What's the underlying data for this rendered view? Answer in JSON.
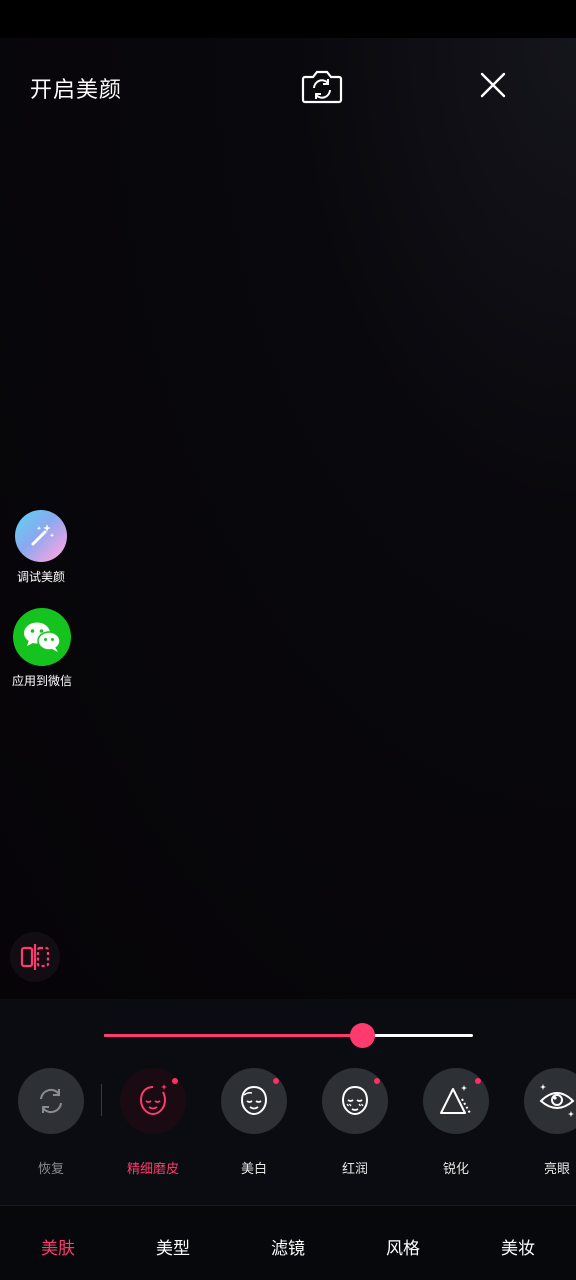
{
  "header": {
    "title": "开启美颜"
  },
  "side": {
    "tune_label": "调试美颜",
    "wechat_label": "应用到微信"
  },
  "slider": {
    "value_fraction": 0.7
  },
  "tools": [
    {
      "label": "恢复",
      "icon": "reset-icon",
      "active": false,
      "dot": false
    },
    {
      "label": "精细磨皮",
      "icon": "face-smooth-icon",
      "active": true,
      "dot": true
    },
    {
      "label": "美白",
      "icon": "face-whiten-icon",
      "active": false,
      "dot": true
    },
    {
      "label": "红润",
      "icon": "face-rosy-icon",
      "active": false,
      "dot": true
    },
    {
      "label": "锐化",
      "icon": "sharpen-icon",
      "active": false,
      "dot": true
    },
    {
      "label": "亮眼",
      "icon": "eye-bright-icon",
      "active": false,
      "dot": false
    }
  ],
  "tabs": [
    {
      "label": "美肤",
      "active": true
    },
    {
      "label": "美型",
      "active": false
    },
    {
      "label": "滤镜",
      "active": false
    },
    {
      "label": "风格",
      "active": false
    },
    {
      "label": "美妆",
      "active": false
    }
  ],
  "colors": {
    "accent": "#ff3a6e",
    "wechat_green": "#14c31d",
    "tool_bg": "#2d3035"
  }
}
